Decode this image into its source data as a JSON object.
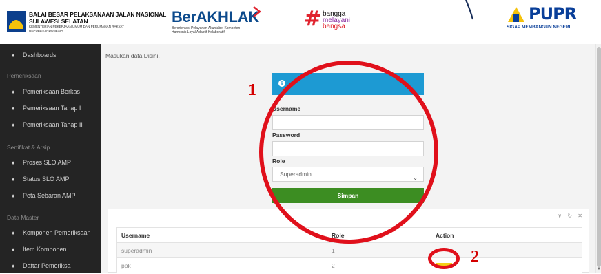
{
  "header": {
    "org_line1": "BALAI BESAR PELAKSANAAN JALAN NASIONAL",
    "org_line2": "SULAWESI SELATAN",
    "org_line3": "KEMENTERIAN PEKERJAAN UMUM DAN PERUMAHAN RAKYAT",
    "org_line4": "REPUBLIK INDONESIA",
    "berakhlak_word_a": "Ber",
    "berakhlak_word_b": "AKHLAK",
    "berakhlak_sub1": "Berorientasi Pelayanan Akuntabel Kompeten",
    "berakhlak_sub2": "Harmonis Loyal Adaptif Kolaboratif",
    "bangga_1": "bangga",
    "bangga_2": "melayani",
    "bangga_3": "bangsa",
    "pupr_brand": "PUPR",
    "pupr_tag": "SIGAP MEMBANGUN NEGERI"
  },
  "sidebar": {
    "dashboards": "Dashboards",
    "section_pemeriksaan": "Pemeriksaan",
    "pemeriksaan_berkas": "Pemeriksaan Berkas",
    "pemeriksaan_tahap1": "Pemeriksaan Tahap I",
    "pemeriksaan_tahap2": "Pemeriksaan Tahap II",
    "section_sertifikat": "Sertifikat & Arsip",
    "proses_slo": "Proses SLO AMP",
    "status_slo": "Status SLO AMP",
    "peta_sebaran": "Peta Sebaran AMP",
    "section_master": "Data Master",
    "komponen_pemeriksaan": "Komponen Pemeriksaan",
    "item_komponen": "Item Komponen",
    "daftar_pemeriksa": "Daftar Pemeriksa"
  },
  "main": {
    "hint": "Masukan data Disini.",
    "info_icon": "i",
    "username_label": "Username",
    "username_value": "",
    "password_label": "Password",
    "password_value": "",
    "role_label": "Role",
    "role_selected": "Superadmin",
    "save_label": "Simpan",
    "panel_tools": "∨ ↻ ✕"
  },
  "table": {
    "columns": [
      "Username",
      "Role",
      "Action"
    ],
    "rows": [
      {
        "username": "superadmin",
        "role": "1"
      },
      {
        "username": "ppk",
        "role": "2"
      }
    ]
  },
  "annotations": {
    "label1": "1",
    "label2": "2",
    "color": "#e0101b"
  },
  "icons": {
    "nav": "home-icon",
    "info": "info-icon",
    "select": "chevron-down-icon"
  },
  "colors": {
    "sidebar_bg": "#242424",
    "info_bar": "#1d9ad3",
    "save_button": "#3c8d22",
    "action_button": "#f4cf17"
  }
}
